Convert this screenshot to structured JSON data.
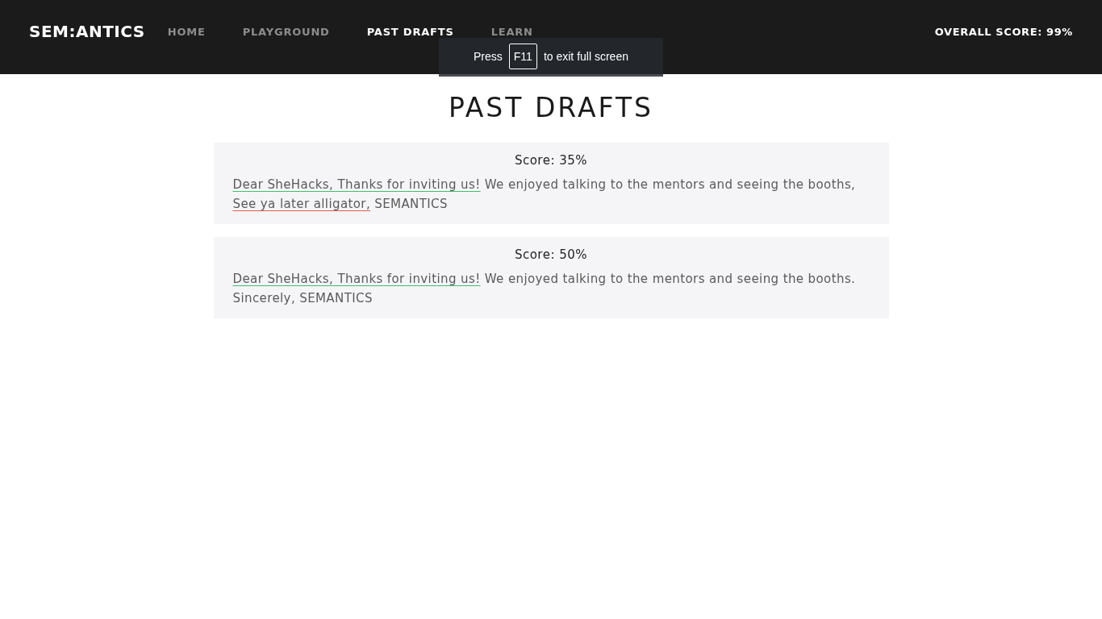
{
  "navbar": {
    "brand": "SEM:ANTICS",
    "links": [
      {
        "label": "HOME",
        "selected": false
      },
      {
        "label": "PLAYGROUND",
        "selected": false
      },
      {
        "label": "PAST DRAFTS",
        "selected": true
      },
      {
        "label": "LEARN",
        "selected": false
      }
    ],
    "overall_score": "OVERALL SCORE: 99%"
  },
  "fullscreen_notice": {
    "before": "Press",
    "key": "F11",
    "after": "to exit full screen"
  },
  "heading": "PAST DRAFTS",
  "drafts": [
    {
      "score": "Score: 35%",
      "segments": [
        {
          "kind": "good",
          "text": "Dear SheHacks, Thanks for inviting us!"
        },
        {
          "kind": "plain",
          "text": " We enjoyed talking to the mentors and seeing the booths, "
        },
        {
          "kind": "bad",
          "text": "See ya later alligator,"
        },
        {
          "kind": "plain",
          "text": " SEMANTICS"
        }
      ]
    },
    {
      "score": "Score: 50%",
      "segments": [
        {
          "kind": "good",
          "text": "Dear SheHacks, Thanks for inviting us!"
        },
        {
          "kind": "plain",
          "text": " We enjoyed talking to the mentors and seeing the booths. Sincerely, SEMANTICS"
        }
      ]
    }
  ]
}
